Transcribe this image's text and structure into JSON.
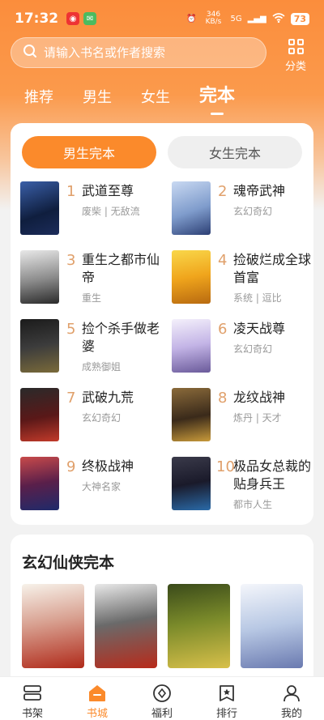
{
  "status": {
    "time": "17:32",
    "net_speed": "346 KB/s",
    "signal": "5G",
    "battery": "73"
  },
  "search": {
    "placeholder": "请输入书名或作者搜索"
  },
  "category": {
    "label": "分类"
  },
  "top_tabs": [
    {
      "label": "推荐",
      "active": false
    },
    {
      "label": "男生",
      "active": false
    },
    {
      "label": "女生",
      "active": false
    },
    {
      "label": "完本",
      "active": true
    }
  ],
  "gender_switch": {
    "male": "男生完本",
    "female": "女生完本"
  },
  "ranking": [
    {
      "rank": "1",
      "title": "武道至尊",
      "tags": "废柴 | 无敌流"
    },
    {
      "rank": "2",
      "title": "魂帝武神",
      "tags": "玄幻奇幻"
    },
    {
      "rank": "3",
      "title": "重生之都市仙帝",
      "tags": "重生"
    },
    {
      "rank": "4",
      "title": "捡破烂成全球首富",
      "tags": "系统 | 逗比"
    },
    {
      "rank": "5",
      "title": "捡个杀手做老婆",
      "tags": "成熟御姐"
    },
    {
      "rank": "6",
      "title": "凌天战尊",
      "tags": "玄幻奇幻"
    },
    {
      "rank": "7",
      "title": "武破九荒",
      "tags": "玄幻奇幻"
    },
    {
      "rank": "8",
      "title": "龙纹战神",
      "tags": "炼丹 | 天才"
    },
    {
      "rank": "9",
      "title": "终极战神",
      "tags": "大神名家"
    },
    {
      "rank": "10",
      "title": "极品女总裁的贴身兵王",
      "tags": "都市人生"
    }
  ],
  "section2": {
    "title": "玄幻仙侠完本"
  },
  "bottom_nav": [
    {
      "label": "书架",
      "icon": "bookshelf-icon",
      "active": false
    },
    {
      "label": "书城",
      "icon": "bookstore-icon",
      "active": true
    },
    {
      "label": "福利",
      "icon": "welfare-icon",
      "active": false
    },
    {
      "label": "排行",
      "icon": "ranking-icon",
      "active": false
    },
    {
      "label": "我的",
      "icon": "profile-icon",
      "active": false
    }
  ],
  "colors": {
    "accent": "#fb8a2b",
    "rank_number": "#e0a06b"
  }
}
